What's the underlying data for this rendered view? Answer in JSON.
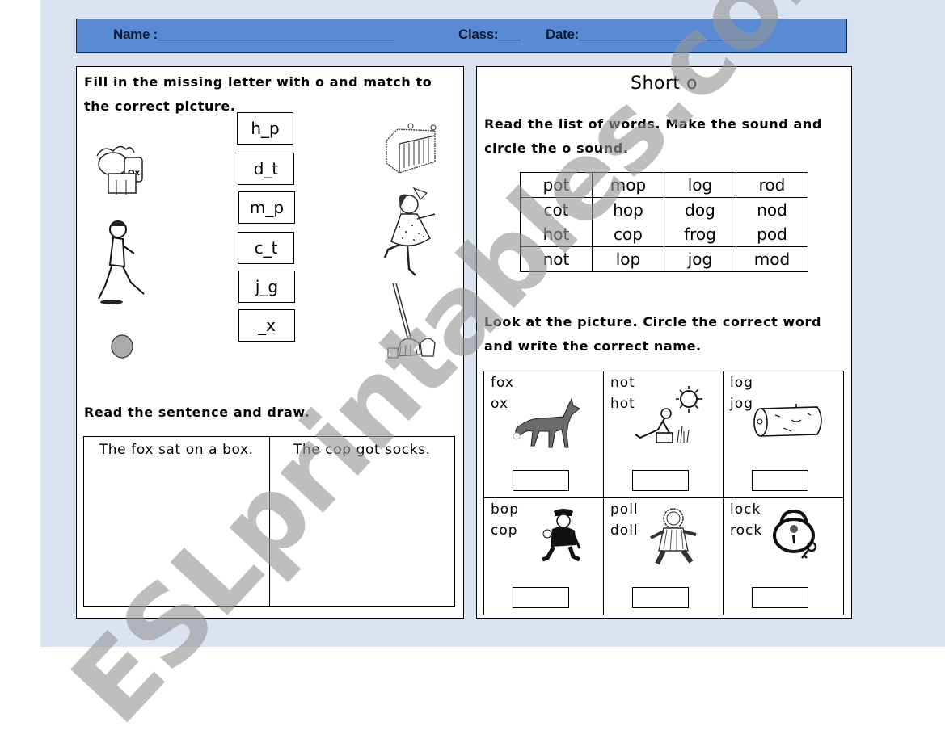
{
  "header": {
    "name_label": "Name :________________________________",
    "class_label": "Class:___",
    "date_label": "Date:_________________________"
  },
  "left": {
    "instruction": "Fill in the missing letter with o and match to the correct picture.",
    "word_boxes": [
      "h_p",
      "d_t",
      "m_p",
      "c_t",
      "j_g",
      "_x"
    ],
    "left_pictures": [
      "ox-icon",
      "jogging-boy-icon",
      "dot-icon"
    ],
    "right_pictures": [
      "cot-crib-icon",
      "hopping-girl-icon",
      "mop-icon"
    ],
    "draw_instruction": "Read the sentence and draw.",
    "draw_sentences": [
      "The fox sat on a box.",
      "The cop got socks."
    ]
  },
  "right": {
    "title": "Short o",
    "instruction1": "Read the list of words. Make the sound and circle the o sound.",
    "word_table": [
      [
        [
          "pot"
        ],
        [
          "mop"
        ],
        [
          "log"
        ],
        [
          "rod"
        ]
      ],
      [
        [
          "cot",
          "hot"
        ],
        [
          "hop",
          "cop"
        ],
        [
          "dog",
          "frog"
        ],
        [
          "nod",
          "pod"
        ]
      ],
      [
        [
          "not"
        ],
        [
          "lop"
        ],
        [
          "jog"
        ],
        [
          "mod"
        ]
      ]
    ],
    "instruction2": "Look at the picture. Circle the correct word and write the correct name.",
    "picture_cells": [
      {
        "options": [
          "fox",
          "ox"
        ],
        "picture": "fox-icon"
      },
      {
        "options": [
          "not",
          "hot"
        ],
        "picture": "hot-sun-man-icon"
      },
      {
        "options": [
          "log",
          "jog"
        ],
        "picture": "log-icon"
      },
      {
        "options": [
          "bop",
          "cop"
        ],
        "picture": "cop-icon"
      },
      {
        "options": [
          "poll",
          "doll"
        ],
        "picture": "doll-icon"
      },
      {
        "options": [
          "lock",
          "rock"
        ],
        "picture": "lock-icon"
      }
    ]
  },
  "watermark": "ESLprintables.com",
  "colors": {
    "header_bg": "#588bd4",
    "page_bg": "#dbe3f1",
    "watermark": "#969696"
  }
}
